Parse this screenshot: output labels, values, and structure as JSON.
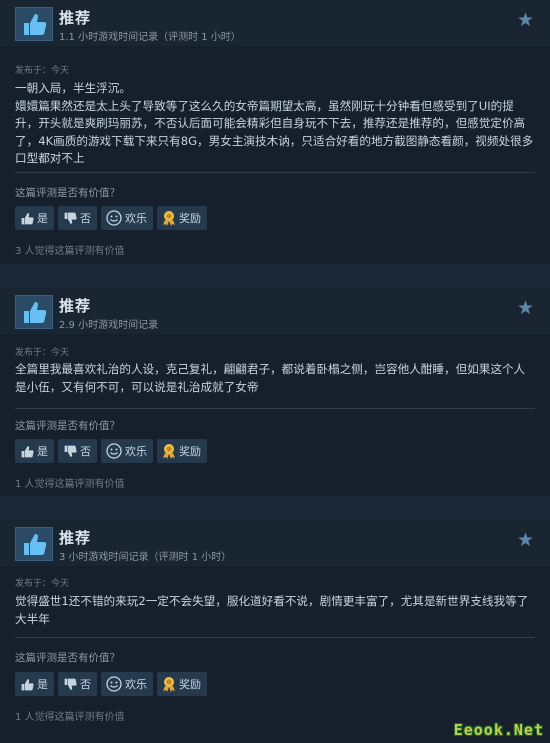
{
  "reviews": [
    {
      "recommend": "推荐",
      "hours": "1.1 小时游戏时间记录（评测时 1 小时）",
      "posted": "发布于：今天",
      "text": "一朝入局，半生浮沉。\n嬛嬛篇果然还是太上头了导致等了这么久的女帝篇期望太高，虽然刚玩十分钟看但感受到了UI的提升，开头就是爽刷玛丽苏，不否认后面可能会精彩但自身玩不下去，推荐还是推荐的，但感觉定价高了，4K画质的游戏下载下来只有8G，男女主演技木讷，只适合好看的地方截图静态看颜，视频处很多口型都对不上",
      "helpful_q": "这篇评测是否有价值？",
      "yes": "是",
      "no": "否",
      "funny": "欢乐",
      "award": "奖励",
      "count": "3 人觉得这篇评测有价值"
    },
    {
      "recommend": "推荐",
      "hours": "2.9 小时游戏时间记录",
      "posted": "发布于：今天",
      "text": "全篇里我最喜欢礼治的人设，克己复礼，翩翩君子，都说着卧榻之侧，岂容他人酣睡，但如果这个人是小伍，又有何不可，可以说是礼治成就了女帝",
      "helpful_q": "这篇评测是否有价值？",
      "yes": "是",
      "no": "否",
      "funny": "欢乐",
      "award": "奖励",
      "count": "1 人觉得这篇评测有价值"
    },
    {
      "recommend": "推荐",
      "hours": "3 小时游戏时间记录（评测时 1 小时）",
      "posted": "发布于：今天",
      "text": "觉得盛世1还不错的来玩2一定不会失望，服化道好看不说，剧情更丰富了，尤其是新世界支线我等了大半年",
      "helpful_q": "这篇评测是否有价值？",
      "yes": "是",
      "no": "否",
      "funny": "欢乐",
      "award": "奖励",
      "count": "1 人觉得这篇评测有价值"
    }
  ],
  "watermark": "Eeook.Net",
  "colors": {
    "background": "#1b2838",
    "card": "#16202d",
    "accent": "#5b87a8",
    "text": "#c6d4df"
  }
}
